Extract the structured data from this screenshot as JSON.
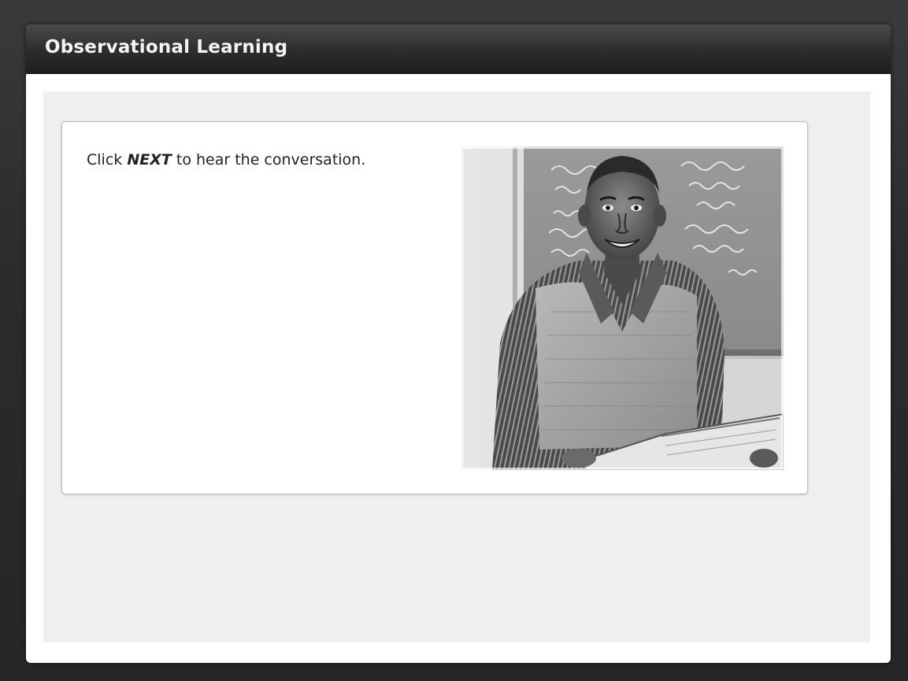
{
  "header": {
    "title": "Observational Learning"
  },
  "card": {
    "instruction_prefix": "Click ",
    "instruction_keyword": "NEXT",
    "instruction_suffix": " to hear the conversation."
  },
  "colors": {
    "page_background": "#2d2d2d",
    "title_bar": "#2e2e2e",
    "content_background": "#efefef",
    "card_background": "#ffffff"
  }
}
